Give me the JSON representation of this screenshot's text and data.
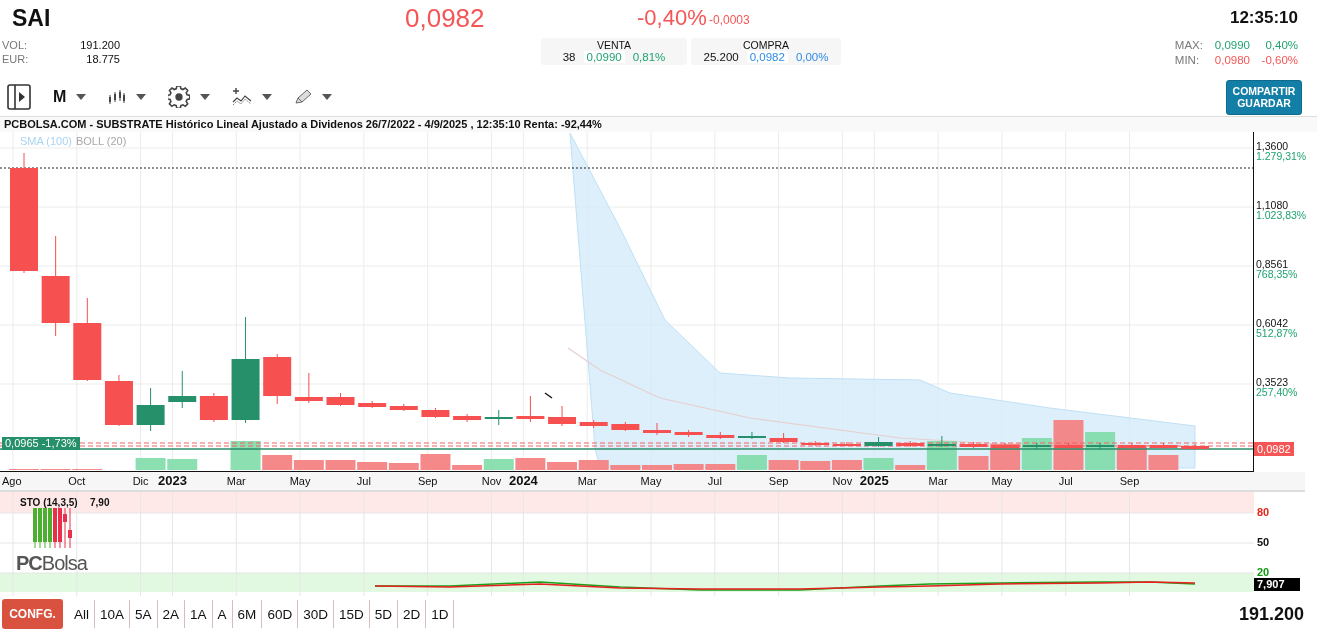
{
  "header": {
    "symbol": "SAI",
    "price": "0,0982",
    "change_pct": "-0,40%",
    "change": "-0,0003",
    "time": "12:35:10"
  },
  "stats": [
    {
      "label": "VOL:",
      "value": "191.200"
    },
    {
      "label": "EUR:",
      "value": "18.775"
    }
  ],
  "quotes": [
    {
      "title": "VENTA",
      "qty": "38",
      "price": "0,0990",
      "pct": "0,81%",
      "kind": "sell"
    },
    {
      "title": "COMPRA",
      "qty": "25.200",
      "price": "0,0982",
      "pct": "0,00%",
      "kind": "buy"
    }
  ],
  "range": [
    {
      "label": "MAX:",
      "value": "0,0990",
      "pct": "0,40%",
      "color": "#1fa36f"
    },
    {
      "label": "MIN:",
      "value": "0,0980",
      "pct": "-0,60%",
      "color": "#f55555"
    }
  ],
  "toolbar": {
    "period": "M"
  },
  "share_button": {
    "lines": [
      "COMPARTIR",
      "GUARDAR"
    ]
  },
  "chart": {
    "title": "PCBOLSA.COM - SUBSTRATE Histórico Lineal Ajustado a Dividenos 26/7/2022 - 4/9/2025 , 12:35:10 Renta: -92,44%",
    "indicators": [
      {
        "label": "SMA (100)",
        "color": "#a9d4f2"
      },
      {
        "label": "BOLL (20)",
        "color": "#a8a8a8"
      }
    ],
    "price_ticks": [
      {
        "price": "1,3600",
        "pct": "1.279,31%"
      },
      {
        "price": "1,1080",
        "pct": "1.023,83%"
      },
      {
        "price": "0,8561",
        "pct": "768,35%"
      },
      {
        "price": "0,6042",
        "pct": "512,87%"
      },
      {
        "price": "0,3523",
        "pct": "257,40%"
      }
    ],
    "last_price": "0,0982",
    "reference": "0,0965  -1,73%",
    "x_labels": [
      {
        "label": "Ago",
        "kind": "month"
      },
      {
        "label": "Oct",
        "kind": "month"
      },
      {
        "label": "Dic",
        "kind": "month"
      },
      {
        "label": "2023",
        "kind": "year"
      },
      {
        "label": "Mar",
        "kind": "month"
      },
      {
        "label": "May",
        "kind": "month"
      },
      {
        "label": "Jul",
        "kind": "month"
      },
      {
        "label": "Sep",
        "kind": "month"
      },
      {
        "label": "Nov",
        "kind": "month"
      },
      {
        "label": "2024",
        "kind": "year"
      },
      {
        "label": "Mar",
        "kind": "month"
      },
      {
        "label": "May",
        "kind": "month"
      },
      {
        "label": "Jul",
        "kind": "month"
      },
      {
        "label": "Sep",
        "kind": "month"
      },
      {
        "label": "Nov",
        "kind": "month"
      },
      {
        "label": "2025",
        "kind": "year"
      },
      {
        "label": "Mar",
        "kind": "month"
      },
      {
        "label": "May",
        "kind": "month"
      },
      {
        "label": "Jul",
        "kind": "month"
      },
      {
        "label": "Sep",
        "kind": "month"
      }
    ]
  },
  "oscillator": {
    "title": "STO (14,3,5)",
    "value": "7,90",
    "ticks": [
      {
        "label": "80",
        "kind": "overbought"
      },
      {
        "label": "50",
        "kind": "mid"
      },
      {
        "label": "20",
        "kind": "oversold"
      }
    ],
    "last_value": "7,907"
  },
  "logo": "**PC**Bolsa",
  "footer": {
    "config_button": "CONFG.",
    "periods": [
      {
        "label": "All",
        "selected": false
      },
      {
        "label": "10A",
        "selected": false
      },
      {
        "label": "5A",
        "selected": false
      },
      {
        "label": "2A",
        "selected": false
      },
      {
        "label": "1A",
        "selected": false
      },
      {
        "label": "A",
        "selected": false
      },
      {
        "label": "6M",
        "selected": false
      },
      {
        "label": "60D",
        "selected": false
      },
      {
        "label": "30D",
        "selected": false
      },
      {
        "label": "15D",
        "selected": false
      },
      {
        "label": "5D",
        "selected": false
      },
      {
        "label": "2D",
        "selected": false
      },
      {
        "label": "1D",
        "selected": false
      }
    ],
    "volume": "191.200"
  }
}
